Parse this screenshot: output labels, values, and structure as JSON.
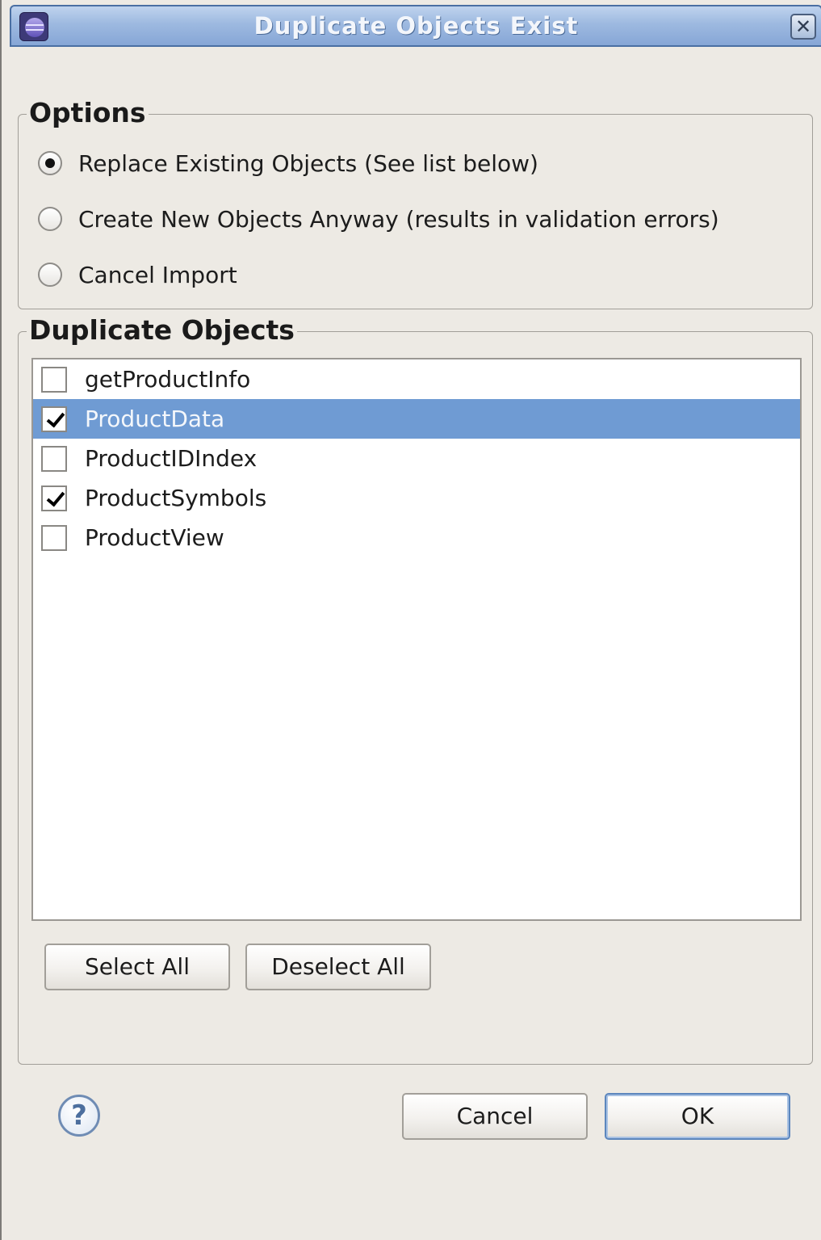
{
  "window": {
    "title": "Duplicate Objects Exist",
    "app_icon": "eclipse-icon",
    "close_glyph": "✕"
  },
  "options": {
    "legend": "Options",
    "choices": [
      {
        "label": "Replace Existing Objects (See list below)",
        "selected": true
      },
      {
        "label": "Create New Objects Anyway (results in validation errors)",
        "selected": false
      },
      {
        "label": "Cancel Import",
        "selected": false
      }
    ]
  },
  "duplicates": {
    "legend": "Duplicate Objects",
    "items": [
      {
        "label": "getProductInfo",
        "checked": false,
        "selected": false
      },
      {
        "label": "ProductData",
        "checked": true,
        "selected": true
      },
      {
        "label": "ProductIDIndex",
        "checked": false,
        "selected": false
      },
      {
        "label": "ProductSymbols",
        "checked": true,
        "selected": false
      },
      {
        "label": "ProductView",
        "checked": false,
        "selected": false
      }
    ],
    "select_all_label": "Select All",
    "deselect_all_label": "Deselect All"
  },
  "footer": {
    "help_icon": "help-icon",
    "help_glyph": "?",
    "cancel_label": "Cancel",
    "ok_label": "OK"
  },
  "colors": {
    "selection": "#6f9bd3",
    "titlebar": "#9db9e0",
    "background": "#edeae4"
  }
}
